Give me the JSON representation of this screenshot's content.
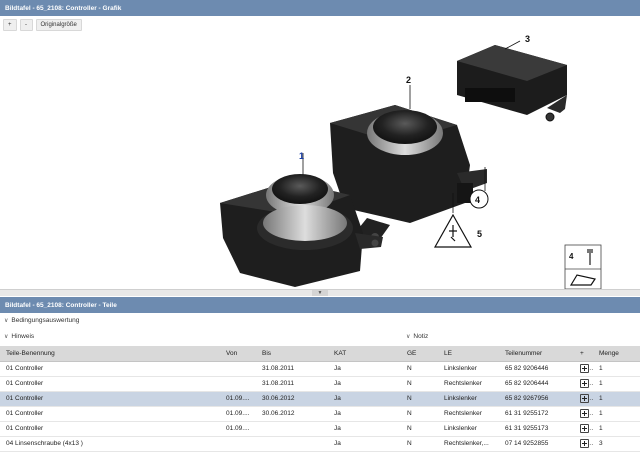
{
  "graphic_panel": {
    "title": "Bildtafel - 65_2108: Controller - Grafik",
    "toolbar": {
      "zoom_in": "+",
      "zoom_out": "-",
      "original_size": "Originalgröße"
    },
    "callouts": {
      "c1": "1",
      "c2": "2",
      "c3": "3",
      "c4": "4",
      "c5": "5",
      "legend_num": "4"
    }
  },
  "parts_panel": {
    "title": "Bildtafel - 65_2108: Controller - Teile",
    "sections": {
      "conditions": "Bedingungsauswertung",
      "hint": "Hinweis",
      "note": "Notiz"
    },
    "columns": [
      "Teile-Benennung",
      "Von",
      "Bis",
      "KAT",
      "GE",
      "LE",
      "Teilenummer",
      "+",
      "Menge"
    ],
    "rows": [
      {
        "name": "01 Controller",
        "von": "",
        "bis": "31.08.2011",
        "kat": "Ja",
        "ge": "N",
        "le": "Linkslenker",
        "number": "65 82 9206446",
        "qty": "1",
        "selected": false
      },
      {
        "name": "01 Controller",
        "von": "",
        "bis": "31.08.2011",
        "kat": "Ja",
        "ge": "N",
        "le": "Rechtslenker",
        "number": "65 82 9206444",
        "qty": "1",
        "selected": false
      },
      {
        "name": "01 Controller",
        "von": "01.09....",
        "bis": "30.06.2012",
        "kat": "Ja",
        "ge": "N",
        "le": "Linkslenker",
        "number": "65 82 9267956",
        "qty": "1",
        "selected": true
      },
      {
        "name": "01 Controller",
        "von": "01.09....",
        "bis": "30.06.2012",
        "kat": "Ja",
        "ge": "N",
        "le": "Rechtslenker",
        "number": "61 31 9255172",
        "qty": "1",
        "selected": false
      },
      {
        "name": "01 Controller",
        "von": "01.09....",
        "bis": "",
        "kat": "Ja",
        "ge": "N",
        "le": "Linkslenker",
        "number": "61 31 9255173",
        "qty": "1",
        "selected": false
      },
      {
        "name": "04 Linsenschraube (4x13 )",
        "von": "",
        "bis": "",
        "kat": "Ja",
        "ge": "N",
        "le": "Rechtslenker,...",
        "number": "07 14 9252855",
        "qty": "3",
        "selected": false
      }
    ]
  },
  "colors": {
    "titlebar": "#6d8bb0",
    "selected_row": "#c9d4e3",
    "header_row": "#d9d9d9"
  }
}
